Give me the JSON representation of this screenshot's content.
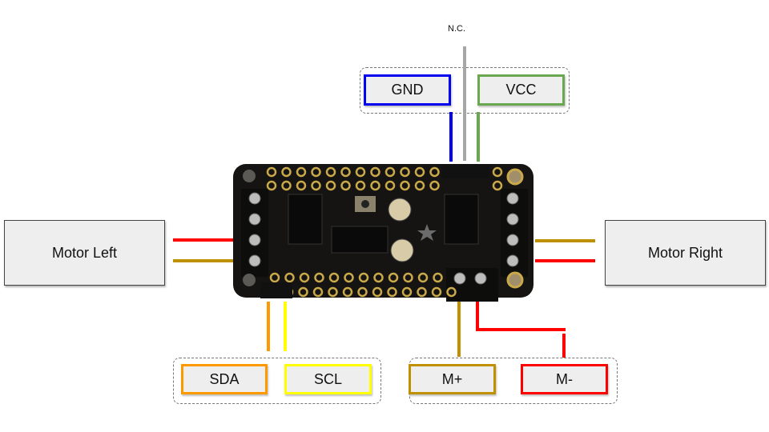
{
  "diagram": {
    "top_label": "N.C.",
    "power_group": {
      "gnd": {
        "label": "GND",
        "color": "#0000ee"
      },
      "vcc": {
        "label": "VCC",
        "color": "#6aa84f"
      },
      "nc_color": "#a6a6a6"
    },
    "motor_left": {
      "label": "Motor Left",
      "wires": [
        "#ff0000",
        "#bf9000"
      ]
    },
    "motor_right": {
      "label": "Motor Right",
      "wires": [
        "#bf9000",
        "#ff0000"
      ]
    },
    "i2c_group": {
      "sda": {
        "label": "SDA",
        "color": "#ff9900"
      },
      "scl": {
        "label": "SCL",
        "color": "#ffff00"
      }
    },
    "power_motor_group": {
      "m_plus": {
        "label": "M+",
        "color": "#bf9000"
      },
      "m_minus": {
        "label": "M-",
        "color": "#ff0000"
      }
    },
    "board": {
      "name": "Motor driver featherwing board"
    }
  }
}
